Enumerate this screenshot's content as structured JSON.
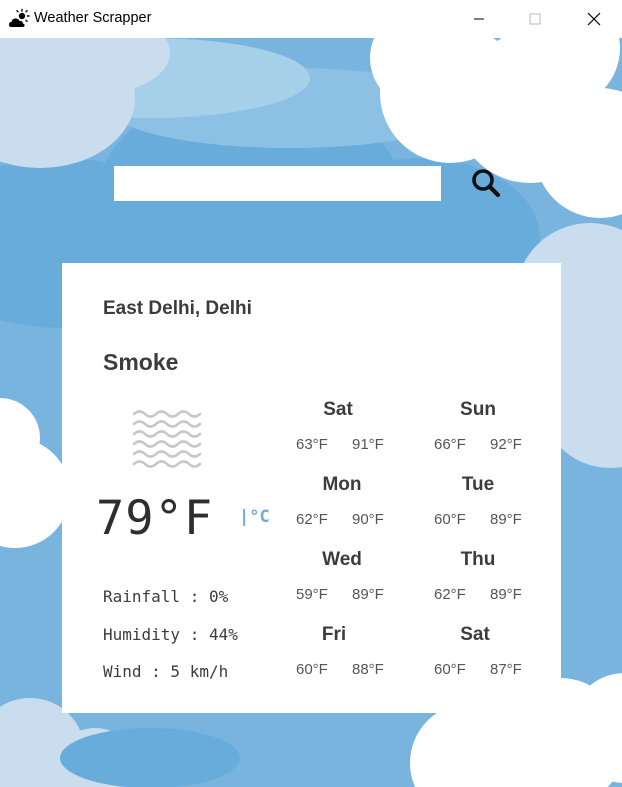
{
  "window": {
    "title": "Weather Scrapper",
    "icon": "cloud-sun-icon"
  },
  "search": {
    "value": "",
    "placeholder": "",
    "button_icon": "search-icon"
  },
  "current": {
    "location": "East Delhi, Delhi",
    "condition": "Smoke",
    "condition_icon": "smoke-haze-icon",
    "temperature": "79°F",
    "unit_toggle": "|°C",
    "rainfall": "Rainfall : 0%",
    "humidity": "Humidity : 44%",
    "wind": "Wind : 5 km/h"
  },
  "forecast": [
    {
      "day": "Sat",
      "low": "63°F",
      "high": "91°F"
    },
    {
      "day": "Sun",
      "low": "66°F",
      "high": "92°F"
    },
    {
      "day": "Mon",
      "low": "62°F",
      "high": "90°F"
    },
    {
      "day": "Tue",
      "low": "60°F",
      "high": "89°F"
    },
    {
      "day": "Wed",
      "low": "59°F",
      "high": "89°F"
    },
    {
      "day": "Thu",
      "low": "62°F",
      "high": "89°F"
    },
    {
      "day": "Fri",
      "low": "60°F",
      "high": "88°F"
    },
    {
      "day": "Sat",
      "low": "60°F",
      "high": "87°F"
    }
  ],
  "colors": {
    "sky": "#79b4df",
    "sky_dark": "#5ea6d8",
    "cloud_light": "#c9ddef",
    "cloud_white": "#ffffff",
    "accent": "#6aaee0",
    "text": "#3c3c3c"
  }
}
